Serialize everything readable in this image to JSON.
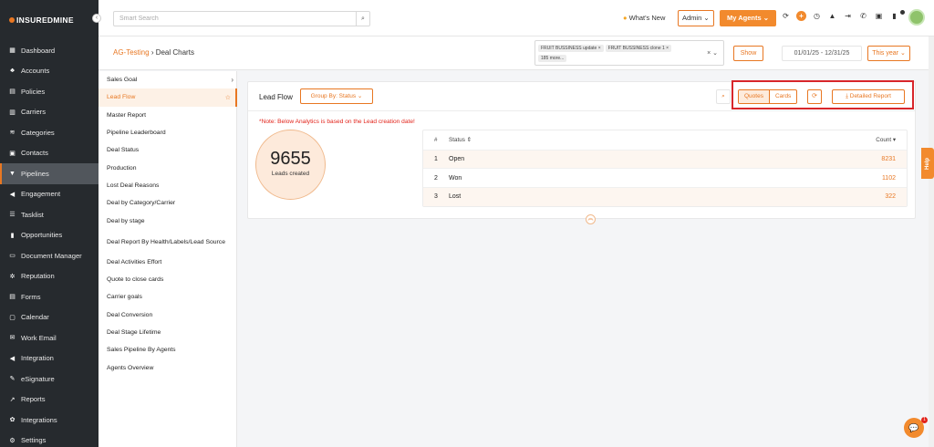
{
  "brand": {
    "logo_text": "INSUREDMINE",
    "accent": "#e87722",
    "sidebar_bg": "#262a2e"
  },
  "sidebar": {
    "items": [
      {
        "label": "Dashboard",
        "icon": "grid-icon"
      },
      {
        "label": "Accounts",
        "icon": "users-icon"
      },
      {
        "label": "Policies",
        "icon": "file-icon"
      },
      {
        "label": "Carriers",
        "icon": "building-icon"
      },
      {
        "label": "Categories",
        "icon": "layers-icon"
      },
      {
        "label": "Contacts",
        "icon": "contact-card-icon"
      },
      {
        "label": "Pipelines",
        "icon": "funnel-icon",
        "active": true
      },
      {
        "label": "Engagement",
        "icon": "megaphone-icon"
      },
      {
        "label": "Tasklist",
        "icon": "checklist-icon"
      },
      {
        "label": "Opportunities",
        "icon": "bar-chart-icon"
      },
      {
        "label": "Document Manager",
        "icon": "folder-icon"
      },
      {
        "label": "Reputation",
        "icon": "star-icon"
      },
      {
        "label": "Forms",
        "icon": "form-icon"
      },
      {
        "label": "Calendar",
        "icon": "calendar-icon"
      },
      {
        "label": "Work Email",
        "icon": "envelope-icon"
      },
      {
        "label": "Integration",
        "icon": "megaphone-icon"
      },
      {
        "label": "eSignature",
        "icon": "signature-icon"
      },
      {
        "label": "Reports",
        "icon": "line-chart-icon"
      },
      {
        "label": "Integrations",
        "icon": "gears-icon"
      },
      {
        "label": "Settings",
        "icon": "gear-icon"
      }
    ]
  },
  "topbar": {
    "search_placeholder": "Smart Search",
    "whats_new": "What's New",
    "admin_label": "Admin",
    "agents_label": "My Agents"
  },
  "subheader": {
    "breadcrumb_parent": "AG-Testing",
    "breadcrumb_current": "Deal Charts",
    "tags": [
      "FRUIT BUSSINESS update",
      "FRUIT BUSSINESS clone 1"
    ],
    "tags_more": "185 more...",
    "show_label": "Show",
    "date_range": "01/01/25 - 12/31/25",
    "period_label": "This year"
  },
  "reports": [
    {
      "label": "Sales Goal",
      "chev": true
    },
    {
      "label": "Lead Flow",
      "active": true
    },
    {
      "label": "Master Report"
    },
    {
      "label": "Pipeline Leaderboard"
    },
    {
      "label": "Deal Status"
    },
    {
      "label": "Production"
    },
    {
      "label": "Lost Deal Reasons"
    },
    {
      "label": "Deal by Category/Carrier"
    },
    {
      "label": "Deal by stage"
    },
    {
      "label": "Deal Report By Health/Labels/Lead Source",
      "two_line": true
    },
    {
      "label": "Deal Activities Effort"
    },
    {
      "label": "Quote to close cards"
    },
    {
      "label": "Carrier goals"
    },
    {
      "label": "Deal Conversion"
    },
    {
      "label": "Deal Stage Lifetime"
    },
    {
      "label": "Sales Pipeline By Agents"
    },
    {
      "label": "Agents Overview"
    }
  ],
  "panel": {
    "title": "Lead Flow",
    "group_by": "Group By: Status",
    "quotes_label": "Quotes",
    "cards_label": "Cards",
    "detailed_report": "Detailed Report",
    "note": "*Note: Below Analytics is based on the Lead creation date!",
    "total_value": "9655",
    "total_label": "Leads created",
    "table": {
      "headers": {
        "index": "#",
        "status": "Status",
        "count": "Count"
      },
      "rows": [
        {
          "index": "1",
          "status": "Open",
          "count": "8231"
        },
        {
          "index": "2",
          "status": "Won",
          "count": "1102"
        },
        {
          "index": "3",
          "status": "Lost",
          "count": "322"
        }
      ]
    }
  },
  "help_label": "Help",
  "chat_badge": "1"
}
